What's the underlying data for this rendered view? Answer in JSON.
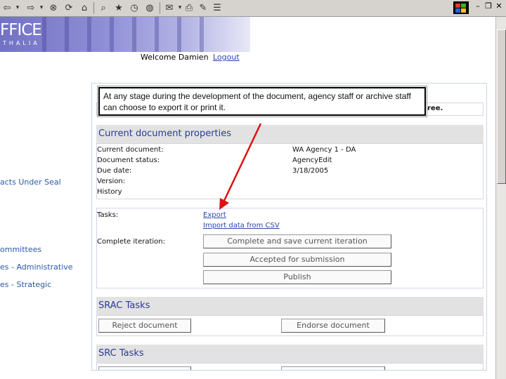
{
  "banner": {
    "title": "FFICE",
    "subtitle": "THALIA"
  },
  "header": {
    "welcome": "Welcome Damien",
    "logout": "Logout"
  },
  "nav": {
    "items": [
      {
        "label": "acts Under Seal"
      },
      {
        "label": "ommittees"
      },
      {
        "label": "es - Administrative"
      },
      {
        "label": "es - Strategic"
      }
    ]
  },
  "callout": {
    "text": "At any stage during the development of the document, agency staff or archive staff can choose to export it or print it."
  },
  "top_row": {
    "tail": "ree."
  },
  "properties": {
    "heading": "Current document properties",
    "rows": [
      {
        "label": "Current document:",
        "value": "WA Agency 1 - DA"
      },
      {
        "label": "Document status:",
        "value": "AgencyEdit"
      },
      {
        "label": "Due date:",
        "value": "3/18/2005"
      },
      {
        "label": "Version:",
        "value": ""
      },
      {
        "label": "History",
        "value": ""
      }
    ]
  },
  "tasks": {
    "label": "Tasks:",
    "export": "Export",
    "import": "Import data from CSV",
    "complete_label": "Complete iteration:",
    "btn_complete": "Complete and save current iteration",
    "btn_accepted": "Accepted for submission",
    "btn_publish": "Publish"
  },
  "srac": {
    "heading": "SRAC Tasks",
    "reject": "Reject document",
    "endorse": "Endorse document"
  },
  "src": {
    "heading": "SRC Tasks"
  },
  "colors": {
    "arrow": "#dd1111",
    "heading": "#2b3a9c",
    "link": "#2a48a8"
  }
}
